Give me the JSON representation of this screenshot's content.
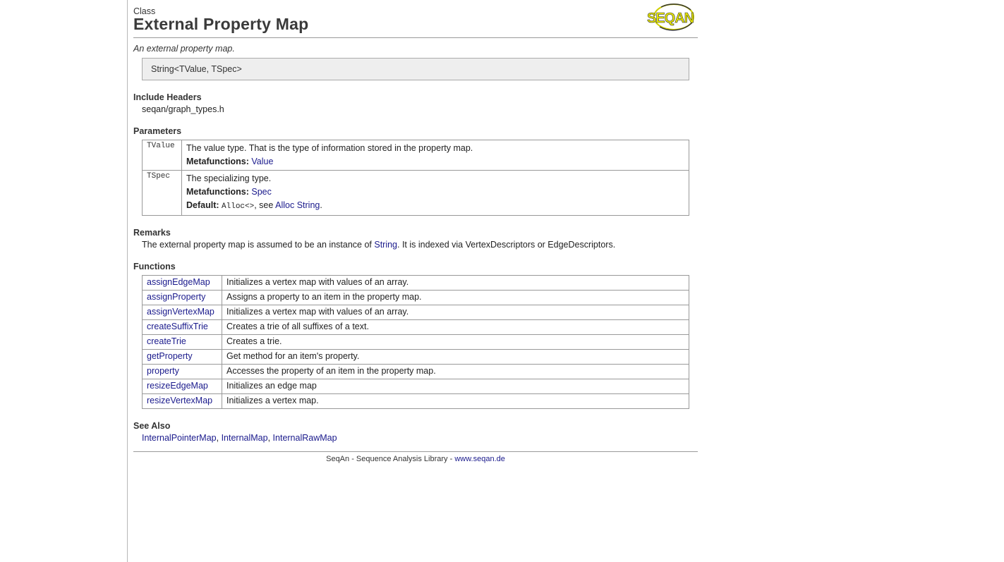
{
  "header": {
    "kind": "Class",
    "title": "External Property Map",
    "logo_text": "SEQAN"
  },
  "summary": "An external property map.",
  "signature": "String<TValue, TSpec>",
  "include_headers": {
    "title": "Include Headers",
    "value": "seqan/graph_types.h"
  },
  "parameters": {
    "title": "Parameters",
    "items": [
      {
        "name": "TValue",
        "desc": "The value type. That is the type of information stored in the property map.",
        "meta_label": "Metafunctions:",
        "meta_link": "Value"
      },
      {
        "name": "TSpec",
        "desc": "The specializing type.",
        "meta_label": "Metafunctions:",
        "meta_link": "Spec",
        "default_label": "Default:",
        "default_code": "Alloc<>",
        "default_see": ", see ",
        "default_link": "Alloc String",
        "default_end": "."
      }
    ]
  },
  "remarks": {
    "title": "Remarks",
    "pre": "The external property map is assumed to be an instance of ",
    "link": "String",
    "post": ". It is indexed via VertexDescriptors or EdgeDescriptors."
  },
  "functions": {
    "title": "Functions",
    "rows": [
      {
        "name": "assignEdgeMap",
        "desc": "Initializes a vertex map with values of an array."
      },
      {
        "name": "assignProperty",
        "desc": "Assigns a property to an item in the property map."
      },
      {
        "name": "assignVertexMap",
        "desc": "Initializes a vertex map with values of an array."
      },
      {
        "name": "createSuffixTrie",
        "desc": "Creates a trie of all suffixes of a text."
      },
      {
        "name": "createTrie",
        "desc": "Creates a trie."
      },
      {
        "name": "getProperty",
        "desc": "Get method for an item's property."
      },
      {
        "name": "property",
        "desc": "Accesses the property of an item in the property map."
      },
      {
        "name": "resizeEdgeMap",
        "desc": "Initializes an edge map"
      },
      {
        "name": "resizeVertexMap",
        "desc": "Initializes a vertex map."
      }
    ]
  },
  "see_also": {
    "title": "See Also",
    "links": [
      "InternalPointerMap",
      "InternalMap",
      "InternalRawMap"
    ],
    "separator": ", "
  },
  "footer": {
    "text": "SeqAn - Sequence Analysis Library - ",
    "link": "www.seqan.de"
  },
  "colors": {
    "link": "#1a1a8c",
    "logo_yellow": "#e6e600",
    "rule": "#999999"
  }
}
